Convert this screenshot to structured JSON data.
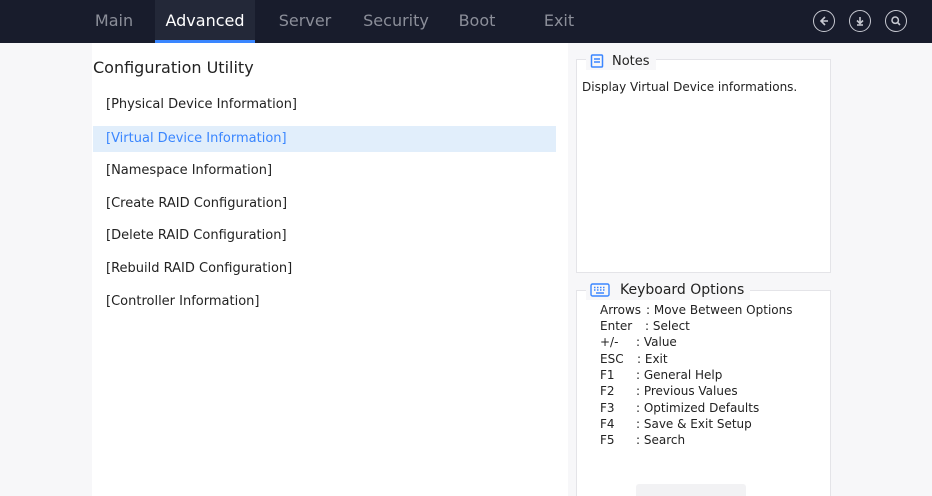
{
  "tabs": [
    {
      "label": "Main",
      "active": false
    },
    {
      "label": "Advanced",
      "active": true
    },
    {
      "label": "Server",
      "active": false
    },
    {
      "label": "Security",
      "active": false
    },
    {
      "label": "Boot",
      "active": false
    },
    {
      "label": "Exit",
      "active": false
    }
  ],
  "top_icons": [
    "back-icon",
    "download-icon",
    "search-icon"
  ],
  "page": {
    "title": "Configuration Utility"
  },
  "menu": [
    {
      "label": "[Physical Device Information]",
      "selected": false
    },
    {
      "label": "[Virtual Device Information]",
      "selected": true
    },
    {
      "label": "[Namespace Information]",
      "selected": false
    },
    {
      "label": "[Create RAID Configuration]",
      "selected": false
    },
    {
      "label": "[Delete RAID Configuration]",
      "selected": false
    },
    {
      "label": "[Rebuild RAID Configuration]",
      "selected": false
    },
    {
      "label": "[Controller Information]",
      "selected": false
    }
  ],
  "notes": {
    "title": "Notes",
    "text": "Display Virtual Device informations."
  },
  "keyboard": {
    "title": "Keyboard Options",
    "rows": [
      {
        "key": "Arrows",
        "desc": ": Move Between Options"
      },
      {
        "key": "Enter",
        "desc": ": Select"
      },
      {
        "key": "+/-",
        "desc": ": Value"
      },
      {
        "key": "ESC",
        "desc": ": Exit"
      },
      {
        "key": "F1",
        "desc": ": General Help"
      },
      {
        "key": "F2",
        "desc": ": Previous Values"
      },
      {
        "key": "F3",
        "desc": ": Optimized Defaults"
      },
      {
        "key": "F4",
        "desc": ": Save & Exit Setup"
      },
      {
        "key": "F5",
        "desc": ": Search"
      }
    ]
  },
  "colors": {
    "topbar": "#181c2c",
    "accent": "#3a86ff",
    "selected_bg": "#e1eefb"
  }
}
